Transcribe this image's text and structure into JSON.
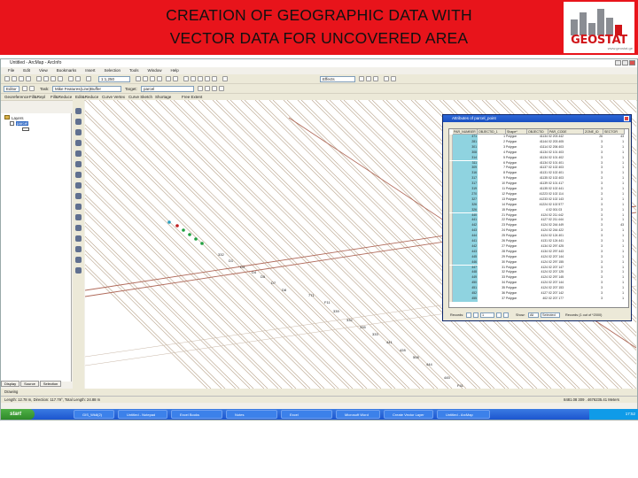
{
  "slide": {
    "title_line1": "CREATION OF GEOGRAPHIC DATA WITH",
    "title_line2": "VECTOR DATA FOR UNCOVERED AREA",
    "logo_text": "GEOSTAT",
    "logo_sub": "www.geostat.ge",
    "accent": "#e8141b"
  },
  "window": {
    "title": "Untitled - ArcMap - ArcInfo",
    "menu": [
      "File",
      "Edit",
      "View",
      "Bookmarks",
      "Insert",
      "Selection",
      "Tools",
      "Window",
      "Help"
    ]
  },
  "toolbars": {
    "scale": "1:1,250",
    "editor_label": "Editor",
    "task_label": "Task:",
    "task_value": "Mike Features(Line)Buffer",
    "target_label": "Target:",
    "target_value": "parcel",
    "effects_label": "Effects",
    "labels_row": [
      "Georeference",
      "Fill&Repl",
      "Fill&Reduce",
      "Edit&Reduce",
      "Curve Vertex",
      "Curve Sketch",
      "Shortage",
      "Free Extent"
    ]
  },
  "toc": {
    "layers_label": "Layers",
    "layer_name": "parcel",
    "tabs": [
      "Display",
      "Source",
      "Selection"
    ]
  },
  "map": {
    "parcel_labels": [
      "332",
      "D1",
      "D3",
      "D4",
      "D5",
      "D7",
      "D8",
      "771",
      "F11",
      "339",
      "332",
      "335",
      "333",
      "441",
      "428",
      "508",
      "444",
      "445",
      "F41"
    ]
  },
  "attributes": {
    "title": "Attributes of parcel_point",
    "columns": [
      "PAR_NUMBER",
      "OBJECTID_1",
      "Shape*",
      "OBJECTID",
      "PAR_CODE",
      "ZONE_ID",
      "SECTOR"
    ],
    "rows": [
      [
        "471",
        "1",
        "Polygon",
        "41134",
        "02 203 442",
        "26",
        "43"
      ],
      [
        "281",
        "2",
        "Polygon",
        "41144",
        "02 203 405",
        "3",
        "1"
      ],
      [
        "301",
        "3",
        "Polygon",
        "41114",
        "02 206 403",
        "3",
        "1"
      ],
      [
        "308",
        "4",
        "Polygon",
        "41134",
        "02 101 403",
        "3",
        "1"
      ],
      [
        "314",
        "5",
        "Polygon",
        "41134",
        "02 101 402",
        "3",
        "1"
      ],
      [
        "311",
        "6",
        "Polygon",
        "41134",
        "02 101 401",
        "3",
        "1"
      ],
      [
        "309",
        "7",
        "Polygon",
        "41137",
        "02 102 403",
        "3",
        "1"
      ],
      [
        "316",
        "8",
        "Polygon",
        "41131",
        "02 102 401",
        "3",
        "1"
      ],
      [
        "317",
        "9",
        "Polygon",
        "41135",
        "02 102 403",
        "3",
        "1"
      ],
      [
        "317",
        "10",
        "Polygon",
        "41139",
        "02 101 417",
        "3",
        "1"
      ],
      [
        "319",
        "11",
        "Polygon",
        "41135",
        "02 102 441",
        "3",
        "1"
      ],
      [
        "270",
        "12",
        "Polygon",
        "41223",
        "02 102 114",
        "3",
        "1"
      ],
      [
        "327",
        "13",
        "Polygon",
        "41233",
        "02 102 143",
        "3",
        "1"
      ],
      [
        "326",
        "14",
        "Polygon",
        "41224",
        "02 102 577",
        "3",
        "1"
      ],
      [
        "326",
        "15",
        "Polygon",
        "4",
        "02 001 03",
        "3",
        "1"
      ],
      [
        "440",
        "21",
        "Polygon",
        "4124",
        "02 211 442",
        "3",
        "1"
      ],
      [
        "441",
        "22",
        "Polygon",
        "4127",
        "02 211 444",
        "3",
        "1"
      ],
      [
        "442",
        "23",
        "Polygon",
        "4124",
        "02 244 449",
        "3",
        "43"
      ],
      [
        "443",
        "24",
        "Polygon",
        "4124",
        "02 244 422",
        "3",
        "1"
      ],
      [
        "444",
        "25",
        "Polygon",
        "4124",
        "02 124 401",
        "3",
        "1"
      ],
      [
        "441",
        "26",
        "Polygon",
        "4131",
        "02 124 441",
        "3",
        "1"
      ],
      [
        "442",
        "27",
        "Polygon",
        "4134",
        "02 297 425",
        "3",
        "1"
      ],
      [
        "443",
        "28",
        "Polygon",
        "4134",
        "02 297 443",
        "3",
        "1"
      ],
      [
        "445",
        "29",
        "Polygon",
        "4124",
        "02 207 144",
        "3",
        "1"
      ],
      [
        "446",
        "30",
        "Polygon",
        "4124",
        "02 297 155",
        "3",
        "1"
      ],
      [
        "447",
        "31",
        "Polygon",
        "4124",
        "02 207 147",
        "3",
        "1"
      ],
      [
        "448",
        "32",
        "Polygon",
        "4124",
        "02 207 125",
        "3",
        "1"
      ],
      [
        "449",
        "33",
        "Polygon",
        "4124",
        "02 297 145",
        "3",
        "1"
      ],
      [
        "450",
        "34",
        "Polygon",
        "4124",
        "02 207 144",
        "3",
        "1"
      ],
      [
        "451",
        "35",
        "Polygon",
        "4124",
        "02 207 153",
        "3",
        "1"
      ],
      [
        "452",
        "36",
        "Polygon",
        "4127",
        "02 207 142",
        "3",
        "1"
      ],
      [
        "455",
        "37",
        "Polygon",
        "402",
        "02 207 177",
        "3",
        "1"
      ]
    ],
    "records_label": "Records:",
    "record_value": "1",
    "show_label": "Show:",
    "show_all": "All",
    "show_selected": "Selected",
    "count_text": "Records (1 out of *2000)"
  },
  "status": {
    "length_text": "Length: 12.78 m, Direction: 117.79°, Total Length: 24.88 m",
    "coords": "8481.08 309 . 4676235.41 Meters",
    "drawing_label": "Drawing"
  },
  "taskbar": {
    "start": "start",
    "items": [
      "GIS_Wk8(2)",
      "Untitled - Notepad",
      "Excel Books",
      "Notes",
      "Excel",
      "Microsoft Word",
      "Create Vector Layer",
      "Untitled - ArcMap"
    ],
    "time": "17:52"
  }
}
